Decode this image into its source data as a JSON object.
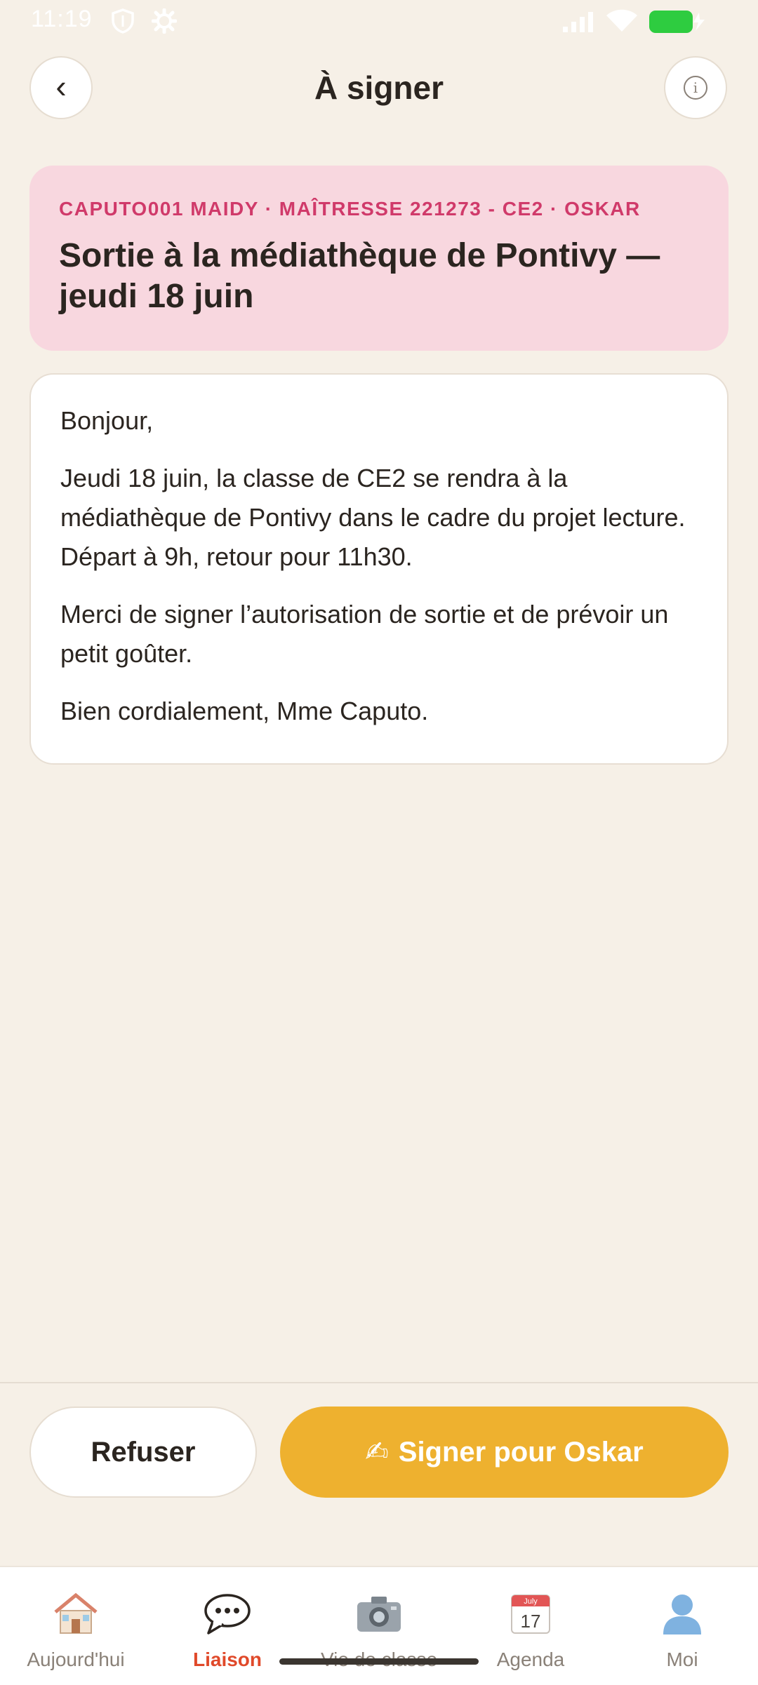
{
  "status_bar": {
    "time": "11:19"
  },
  "header": {
    "title": "À signer"
  },
  "banner": {
    "meta": "CAPUTO001 MAIDY · MAÎTRESSE 221273 - CE2 · OSKAR",
    "title": "Sortie à la médiathèque de Pontivy — jeudi 18 juin"
  },
  "message": {
    "paragraphs": [
      "Bonjour,",
      "Jeudi 18 juin, la classe de CE2 se rendra à la médiathèque de Pontivy dans le cadre du projet lecture. Départ à 9h, retour pour 11h30.",
      "Merci de signer l’autorisation de sortie et de prévoir un petit goûter.",
      "Bien cordialement, Mme Caputo."
    ]
  },
  "actions": {
    "refuse_label": "Refuser",
    "sign_icon": "✍",
    "sign_label": "Signer pour Oskar"
  },
  "tabbar": {
    "tabs": [
      {
        "label": "Aujourd'hui",
        "icon": "house-icon",
        "active": false
      },
      {
        "label": "Liaison",
        "icon": "speech-bubble-icon",
        "active": true
      },
      {
        "label": "Vie de classe",
        "icon": "camera-icon",
        "active": false
      },
      {
        "label": "Agenda",
        "icon": "calendar-icon",
        "active": false,
        "icon_text_month": "July",
        "icon_text_day": "17"
      },
      {
        "label": "Moi",
        "icon": "person-icon",
        "active": false
      }
    ]
  },
  "colors": {
    "background": "#f6f0e7",
    "banner_bg": "#f8d7df",
    "banner_meta": "#d03a6a",
    "sign_button": "#eeb12f",
    "active_tab": "#e0492a"
  }
}
